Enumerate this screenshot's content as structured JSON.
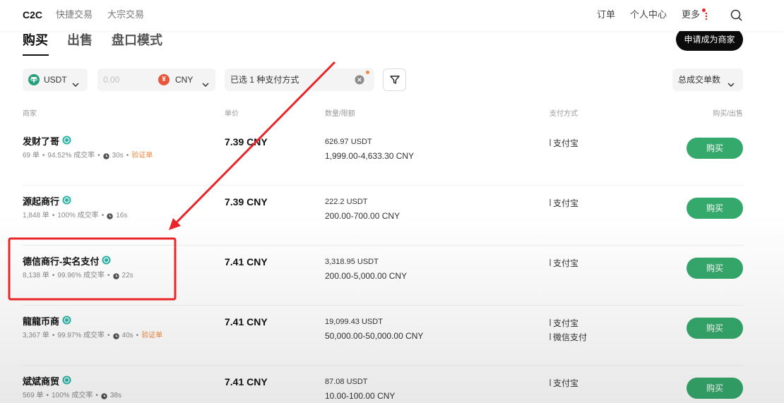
{
  "nav": {
    "brand": "C2C",
    "quick_trade": "快捷交易",
    "block_trade": "大宗交易",
    "orders": "订单",
    "profile": "个人中心",
    "more": "更多"
  },
  "tabs": {
    "buy": "购买",
    "sell": "出售",
    "orderbook": "盘口模式"
  },
  "apply_merchant": "申请成为商家",
  "filters": {
    "crypto": "USDT",
    "amount_placeholder": "0.00",
    "fiat_symbol": "¥",
    "fiat": "CNY",
    "payment": "已选 1 种支付方式",
    "sort": "总成交单数"
  },
  "table_headers": {
    "merchant": "商家",
    "price": "单价",
    "quantity": "数量/限额",
    "payment": "支付方式",
    "action": "购买/出售"
  },
  "separator": "•",
  "rows": [
    {
      "name": "发财了哥",
      "orders": "69 单",
      "rate": "94.52% 成交率",
      "time": "30s",
      "badge": "验证单",
      "price": "7.39 CNY",
      "quantity": "626.97 USDT",
      "limit": "1,999.00-4,633.30 CNY",
      "payments": [
        "支付宝"
      ],
      "action": "购买"
    },
    {
      "name": "源起商行",
      "orders": "1,848 单",
      "rate": "100% 成交率",
      "time": "16s",
      "price": "7.39 CNY",
      "quantity": "222.2 USDT",
      "limit": "200.00-700.00 CNY",
      "payments": [
        "支付宝"
      ],
      "action": "购买"
    },
    {
      "name": "德信商行-实名支付",
      "orders": "8,138 单",
      "rate": "99.96% 成交率",
      "time": "22s",
      "price": "7.41 CNY",
      "quantity": "3,318.95 USDT",
      "limit": "200.00-5,000.00 CNY",
      "payments": [
        "支付宝"
      ],
      "action": "购买"
    },
    {
      "name": "龍龍币商",
      "orders": "3,367 单",
      "rate": "99.97% 成交率",
      "time": "40s",
      "badge": "验证单",
      "price": "7.41 CNY",
      "quantity": "19,099.43 USDT",
      "limit": "50,000.00-50,000.00 CNY",
      "payments": [
        "支付宝",
        "微信支付"
      ],
      "action": "购买"
    },
    {
      "name": "斌斌商贸",
      "orders": "569 单",
      "rate": "100% 成交率",
      "time": "38s",
      "price": "7.41 CNY",
      "quantity": "87.08 USDT",
      "limit": "10.00-100.00 CNY",
      "payments": [
        "支付宝"
      ],
      "action": "购买"
    }
  ],
  "colors": {
    "buy_button": "#35a86b",
    "apply_button": "#0b0b0b",
    "verified_badge": "#2bb5a6",
    "verification_tag": "#f0883e",
    "notification_dot": "#e8262a",
    "tether": "#26a17b",
    "cny_icon": "#e8573b",
    "annotation": "#e8262a"
  },
  "icons": {
    "search": "search-icon",
    "more": "vertical-dots-icon",
    "crypto": "tether-icon",
    "fiat": "cny-icon",
    "dropdown": "chevron-down-icon",
    "clear": "clear-icon",
    "filter": "filter-icon",
    "verified": "verified-icon",
    "release_time": "clock-icon"
  }
}
